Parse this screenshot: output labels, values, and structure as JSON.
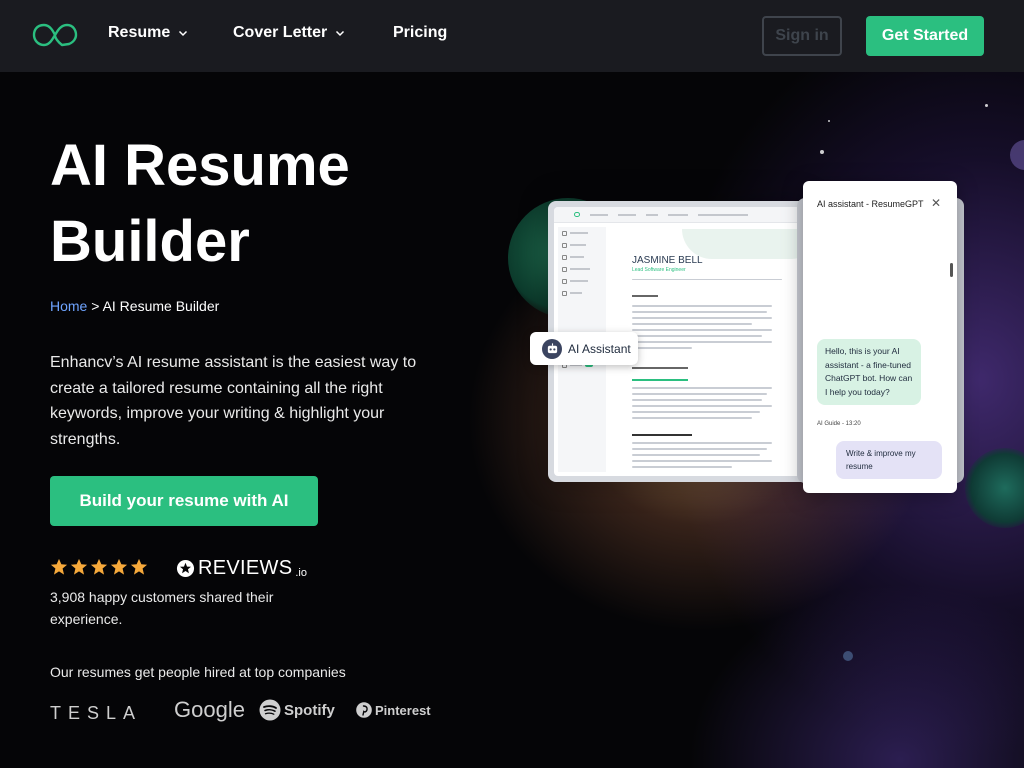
{
  "nav": {
    "logo_icon": "infinity-heart-logo",
    "items": [
      {
        "label": "Resume",
        "has_dropdown": true
      },
      {
        "label": "Cover Letter",
        "has_dropdown": true
      },
      {
        "label": "Pricing",
        "has_dropdown": false
      }
    ],
    "sign_in_label": "Sign in",
    "get_started_label": "Get Started"
  },
  "hero": {
    "title_line1": "AI Resume",
    "title_line2": "Builder",
    "breadcrumb": {
      "home": "Home",
      "separator": ">",
      "current": "AI Resume Builder"
    },
    "description": "Enhancv’s AI resume assistant is the easiest way to create a tailored resume containing all the right keywords, improve your writing & highlight your strengths.",
    "cta_label": "Build your resume with AI",
    "rating_stars": 5,
    "reviews_brand": "REVIEWS",
    "reviews_suffix": ".io",
    "customers_text": "3,908 happy customers shared their experience.",
    "hired_text": "Our resumes get people hired at top companies",
    "companies": [
      "TESLA",
      "Google",
      "Spotify",
      "Pinterest"
    ]
  },
  "mockup": {
    "resume_name": "JASMINE BELL",
    "resume_role": "Lead Software Engineer",
    "ai_assistant_label": "AI Assistant",
    "chat_title": "AI assistant - ResumeGPT",
    "bot_message": "Hello, this is your AI assistant - a fine-tuned ChatGPT bot. How can I help you today?",
    "bot_time": "AI Guide - 13:20",
    "user_message": "Write & improve my resume"
  },
  "colors": {
    "brand_green": "#2bbf80",
    "nav_bg": "#1a1b20",
    "link_blue": "#6fa4ff",
    "star": "#f6a93b"
  }
}
